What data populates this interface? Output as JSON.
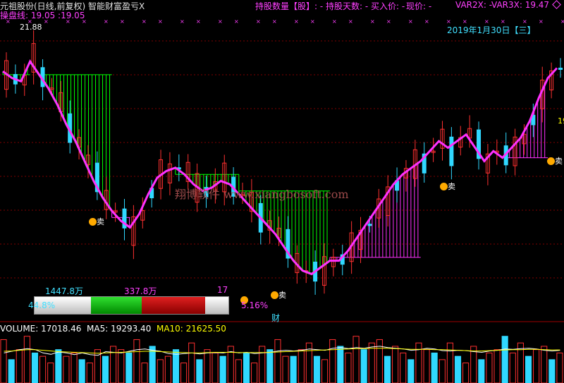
{
  "header": {
    "left_title": "元祖股份(日线,前复权) 智能财富盈亏",
    "close_mark": "X",
    "line_label": "操盘线",
    "line_value1": "19.05",
    "line_value2": "19.05",
    "holdings_label": "持股数量【股】: -",
    "days_label": "持股天数: -",
    "buy_label": "买入价: -",
    "price_label": "现价: -",
    "var2x": "VAR2X: -",
    "var3x": "VAR3X: 19.47"
  },
  "date_label": "2019年1月30日【三】",
  "watermark": "翔博软件  www.xiangbosoft.com",
  "max_price_label": "21.88",
  "right_edge_label": "19",
  "indicator_box": {
    "left_value": "1447.8万",
    "mid_value": "337.8万",
    "right_value": "17",
    "pct_left": "44.8%",
    "pct_right": "5.16%",
    "finance_mark": "财"
  },
  "sell_marks": [
    "卖",
    "卖",
    "卖",
    "卖",
    "卖"
  ],
  "volume_header": {
    "volume": "VOLUME: 17018.46",
    "ma5": "MA5: 19293.40",
    "ma10": "MA10: 21625.50"
  },
  "colors": {
    "up": "#ff3030",
    "down": "#30d8ff",
    "line_green": "#00ff00",
    "line_magenta": "#ff30ff",
    "grid": "#800000"
  },
  "chart_data": {
    "type": "line",
    "series": [
      {
        "values": [
          20.6,
          20.4,
          20.3,
          20.9,
          20.5,
          20.1,
          19.6,
          19.0,
          18.5,
          17.9,
          17.3,
          16.8,
          16.4,
          16.1,
          15.9,
          16.3,
          16.9,
          17.4,
          17.6,
          17.7,
          17.5,
          17.2,
          17.0,
          17.1,
          17.3,
          17.2,
          16.9,
          16.6,
          16.3,
          16.0,
          15.7,
          15.3,
          14.9,
          14.6,
          14.5,
          14.7,
          14.9,
          14.9,
          15.2,
          15.6,
          16.0,
          16.4,
          16.8,
          17.2,
          17.5,
          17.7,
          17.9,
          18.2,
          18.5,
          18.3,
          18.5,
          18.7,
          18.3,
          17.9,
          18.2,
          18.0,
          18.3,
          18.6,
          19.1,
          19.8,
          20.4,
          20.7
        ]
      }
    ],
    "volume_values": [
      13,
      7,
      10,
      14,
      9,
      8,
      6,
      10,
      8,
      9,
      7,
      6,
      10,
      8,
      11,
      10,
      9,
      13,
      6,
      11,
      7,
      8,
      10,
      6,
      12,
      7,
      10,
      9,
      8,
      11,
      7,
      9,
      6,
      11,
      10,
      13,
      8,
      8,
      10,
      12,
      8,
      7,
      13,
      11,
      9,
      14,
      10,
      12,
      13,
      8,
      11,
      9,
      7,
      12,
      10,
      9,
      7,
      12,
      8,
      6,
      11,
      7,
      9,
      10,
      14,
      9,
      12,
      8,
      10,
      11,
      7,
      9
    ],
    "ma5": [
      9,
      9.5,
      10,
      10.3,
      10,
      9,
      8.6,
      9.3,
      9,
      8.5,
      9,
      8.5,
      8.3,
      9.4,
      9.2,
      9,
      9.5,
      10,
      10.2,
      9.8,
      9.5,
      8.8,
      8.6,
      8.8,
      9,
      8.7,
      9,
      9.1,
      9,
      9.4,
      9,
      9.2,
      8.8,
      9,
      9.2,
      9.6,
      9.8,
      9.6,
      9.8,
      10.2,
      10,
      9.8,
      10.4,
      10.6,
      10.3,
      10.6,
      10.4,
      10.8,
      11,
      10.6,
      10.4,
      10.2,
      9.8,
      10,
      10.4,
      10.2,
      9.7,
      9.6,
      9.8,
      9.7,
      9.4,
      9.2,
      9.6,
      9.8,
      10.2,
      10.1,
      10.3,
      10.4,
      10.2,
      9.8,
      9.6,
      9.8
    ],
    "ma10": [
      9.5,
      9.6,
      9.8,
      10,
      10,
      9.8,
      9.6,
      9.4,
      9.3,
      9.2,
      9.1,
      9,
      8.9,
      9,
      9.1,
      9.2,
      9.3,
      9.4,
      9.5,
      9.5,
      9.4,
      9.3,
      9.2,
      9.1,
      9,
      9,
      9.1,
      9.2,
      9.2,
      9.2,
      9.1,
      9.1,
      9.1,
      9.1,
      9.2,
      9.3,
      9.4,
      9.5,
      9.6,
      9.7,
      9.8,
      9.9,
      10,
      10.1,
      10.2,
      10.3,
      10.3,
      10.4,
      10.4,
      10.4,
      10.3,
      10.2,
      10.1,
      10.1,
      10.1,
      10,
      10,
      9.9,
      9.8,
      9.7,
      9.6,
      9.6,
      9.7,
      9.8,
      9.9,
      10,
      10,
      10.1,
      10.1,
      10,
      9.9,
      9.9
    ]
  }
}
